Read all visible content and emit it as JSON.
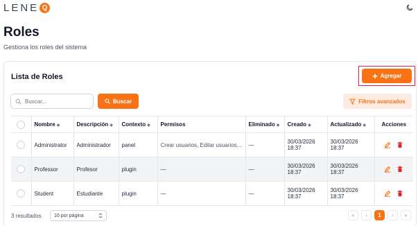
{
  "brand": {
    "logo_text": "LENE",
    "logo_mark": "Q",
    "accent": "#f97316"
  },
  "header": {
    "title": "Roles",
    "subtitle": "Gestiona los roles del sistema"
  },
  "card": {
    "title": "Lista de Roles",
    "add_label": "Agregar",
    "search_placeholder": "Buscar...",
    "search_label": "Buscar",
    "filters_label": "Filtros avanzados"
  },
  "table": {
    "columns": [
      "Nombre",
      "Descripción",
      "Contexto",
      "Permisos",
      "Eliminado",
      "Creado",
      "Actualizado",
      "Acciones"
    ],
    "rows": [
      {
        "nombre": "Administrator",
        "descripcion": "Administrador",
        "contexto": "panel",
        "permisos": "Crear usuarios, Editar usuarios...",
        "eliminado": "—",
        "creado_fecha": "30/03/2026",
        "creado_hora": "18:37",
        "actualizado_fecha": "30/03/2026",
        "actualizado_hora": "18:37"
      },
      {
        "nombre": "Professor",
        "descripcion": "Profesor",
        "contexto": "plugin",
        "permisos": "—",
        "eliminado": "—",
        "creado_fecha": "30/03/2026",
        "creado_hora": "18:37",
        "actualizado_fecha": "30/03/2026",
        "actualizado_hora": "18:37"
      },
      {
        "nombre": "Student",
        "descripcion": "Estudiante",
        "contexto": "plugin",
        "permisos": "—",
        "eliminado": "—",
        "creado_fecha": "30/03/2026",
        "creado_hora": "18:37",
        "actualizado_fecha": "30/03/2026",
        "actualizado_hora": "18:37"
      }
    ]
  },
  "footer": {
    "results": "3 resultados",
    "per_page": "10 por página",
    "current_page": "1"
  }
}
